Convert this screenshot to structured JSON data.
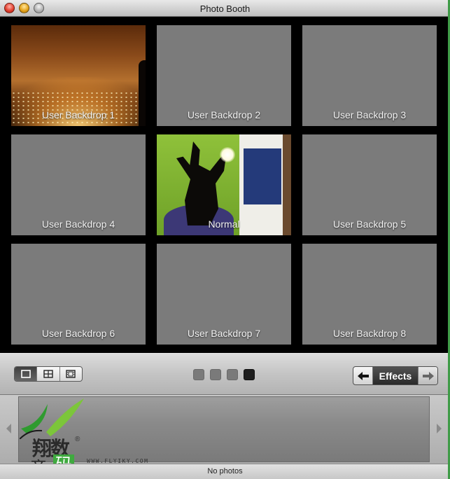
{
  "window": {
    "title": "Photo Booth"
  },
  "effects": {
    "tiles": [
      {
        "label": "User Backdrop 1"
      },
      {
        "label": "User Backdrop 2"
      },
      {
        "label": "User Backdrop 3"
      },
      {
        "label": "User Backdrop 4"
      },
      {
        "label": "Normal"
      },
      {
        "label": "User Backdrop 5"
      },
      {
        "label": "User Backdrop 6"
      },
      {
        "label": "User Backdrop 7"
      },
      {
        "label": "User Backdrop 8"
      }
    ],
    "page_count": 4,
    "current_page": 4
  },
  "toolbar": {
    "view_modes": [
      "single-photo-icon",
      "four-up-icon",
      "movie-clip-icon"
    ],
    "active_view_mode": "single-photo-icon",
    "effects_label": "Effects"
  },
  "watermark": {
    "url": "WWW.FLYIKY.COM"
  },
  "status": {
    "text": "No photos"
  },
  "colors": {
    "tile_gray": "#7b7b7b",
    "accent_green": "#3faa3f"
  }
}
